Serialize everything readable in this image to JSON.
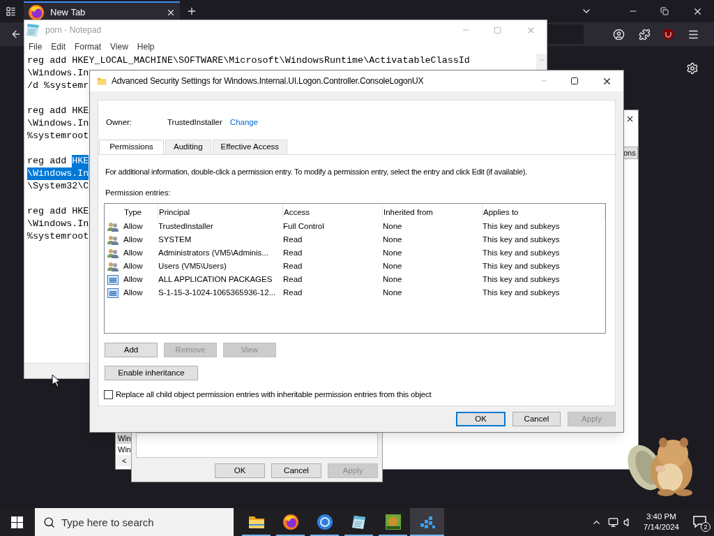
{
  "browser": {
    "tabs": [
      {
        "label": "New Tab",
        "selected": true
      }
    ]
  },
  "notepad": {
    "title": "porn - Notepad",
    "menu": [
      "File",
      "Edit",
      "Format",
      "View",
      "Help"
    ],
    "blocks": [
      [
        [
          {
            "text": "reg add HKEY_LOCAL_MACHINE\\SOFTWARE\\Microsoft\\WindowsRuntime\\ActivatableClassId",
            "selected": false
          }
        ],
        [
          {
            "text": "\\Windows.In",
            "selected": false
          }
        ],
        [
          {
            "text": "/d %systemr",
            "selected": false
          }
        ]
      ],
      [
        [
          {
            "text": "reg add HKE",
            "selected": false
          }
        ],
        [
          {
            "text": "\\Windows.In",
            "selected": false
          }
        ],
        [
          {
            "text": "%systemroot",
            "selected": false
          }
        ]
      ],
      [
        [
          {
            "text": "reg add ",
            "selected": false
          },
          {
            "text": "HKE",
            "selected": true
          }
        ],
        [
          {
            "text": "\\Windows.In",
            "selected": true
          }
        ],
        [
          {
            "text": "\\System32\\C",
            "selected": false
          }
        ]
      ],
      [
        [
          {
            "text": "reg add HKE",
            "selected": false
          }
        ],
        [
          {
            "text": "\\Windows.In",
            "selected": false
          }
        ],
        [
          {
            "text": "%systemroot",
            "selected": false
          }
        ]
      ]
    ]
  },
  "background_window": {
    "partial_button": "ons",
    "list_items": [
      {
        "text": "Win",
        "selected": true
      },
      {
        "text": "Win",
        "selected": false
      }
    ],
    "scroll_left": "<",
    "dialog_buttons": [
      {
        "label": "OK",
        "disabled": false
      },
      {
        "label": "Cancel",
        "disabled": false
      },
      {
        "label": "Apply",
        "disabled": true
      }
    ]
  },
  "dialog": {
    "title": "Advanced Security Settings for Windows.Internal.UI.Logon.Controller.ConsoleLogonUX",
    "owner_label": "Owner:",
    "owner": "TrustedInstaller",
    "change_link": "Change",
    "tabs": [
      {
        "label": "Permissions",
        "selected": true
      },
      {
        "label": "Auditing",
        "selected": false
      },
      {
        "label": "Effective Access",
        "selected": false
      }
    ],
    "description": "For additional information, double-click a permission entry. To modify a permission entry, select the entry and click Edit (if available).",
    "entries_label": "Permission entries:",
    "columns": [
      "Type",
      "Principal",
      "Access",
      "Inherited from",
      "Applies to"
    ],
    "rows": [
      {
        "kind": "group",
        "type": "Allow",
        "principal": "TrustedInstaller",
        "access": "Full Control",
        "inherited_from": "None",
        "applies_to": "This key and subkeys"
      },
      {
        "kind": "group",
        "type": "Allow",
        "principal": "SYSTEM",
        "access": "Read",
        "inherited_from": "None",
        "applies_to": "This key and subkeys"
      },
      {
        "kind": "group",
        "type": "Allow",
        "principal": "Administrators (VM5\\Adminis...",
        "access": "Read",
        "inherited_from": "None",
        "applies_to": "This key and subkeys"
      },
      {
        "kind": "group",
        "type": "Allow",
        "principal": "Users (VM5\\Users)",
        "access": "Read",
        "inherited_from": "None",
        "applies_to": "This key and subkeys"
      },
      {
        "kind": "package",
        "type": "Allow",
        "principal": "ALL APPLICATION PACKAGES",
        "access": "Read",
        "inherited_from": "None",
        "applies_to": "This key and subkeys"
      },
      {
        "kind": "package",
        "type": "Allow",
        "principal": "S-1-15-3-1024-1065365936-12...",
        "access": "Read",
        "inherited_from": "None",
        "applies_to": "This key and subkeys"
      }
    ],
    "entry_buttons": [
      {
        "label": "Add",
        "disabled": false
      },
      {
        "label": "Remove",
        "disabled": true
      },
      {
        "label": "View",
        "disabled": true
      }
    ],
    "inheritance_button": "Enable inheritance",
    "replace_checkbox": {
      "label": "Replace all child object permission entries with inheritable permission entries from this object",
      "checked": false
    },
    "buttons": [
      {
        "label": "OK",
        "disabled": false,
        "default": true
      },
      {
        "label": "Cancel",
        "disabled": false,
        "default": false
      },
      {
        "label": "Apply",
        "disabled": true,
        "default": false
      }
    ]
  },
  "taskbar": {
    "search_placeholder": "Type here to search",
    "apps": [
      {
        "kind": "folder",
        "running": true,
        "selected": false
      },
      {
        "kind": "firefox",
        "running": true,
        "selected": false
      },
      {
        "kind": "chrome",
        "running": true,
        "selected": false
      },
      {
        "kind": "notepad",
        "running": true,
        "selected": false
      },
      {
        "kind": "game",
        "running": true,
        "selected": false
      },
      {
        "kind": "blocks",
        "running": true,
        "selected": true
      }
    ],
    "time": "3:40 PM",
    "date": "7/14/2024",
    "notification_count": "2"
  }
}
